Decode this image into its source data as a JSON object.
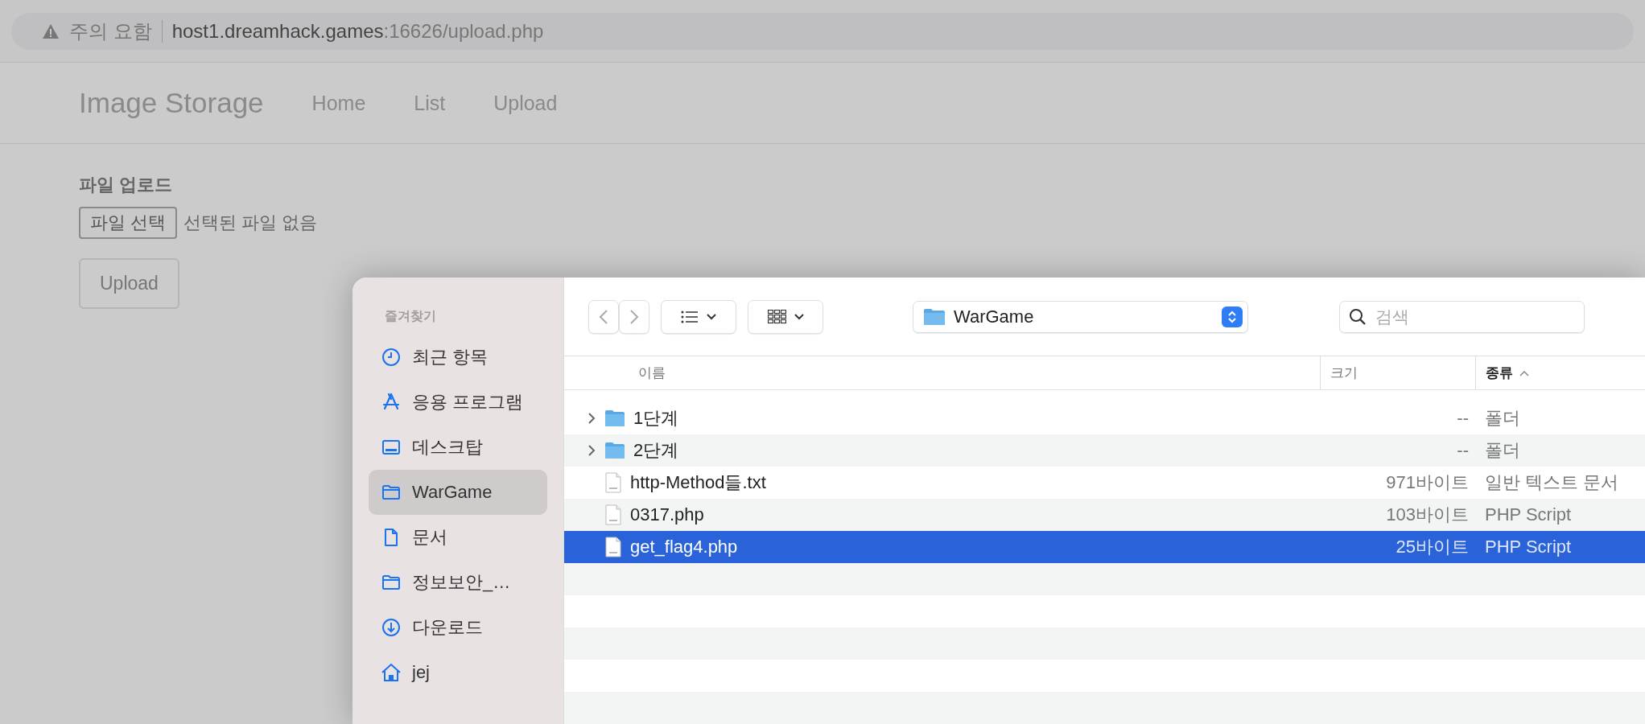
{
  "browser": {
    "warning": "주의 요함",
    "url_host": "host1.dreamhack.games",
    "url_rest": ":16626/upload.php"
  },
  "site": {
    "brand": "Image Storage",
    "nav": [
      {
        "label": "Home"
      },
      {
        "label": "List"
      },
      {
        "label": "Upload"
      }
    ],
    "heading": "파일 업로드",
    "file_button": "파일 선택",
    "file_status": "선택된 파일 없음",
    "upload_button": "Upload"
  },
  "dialog": {
    "sidebar": {
      "section": "즐겨찾기",
      "items": [
        {
          "label": "최근 항목",
          "kind": "recent",
          "selected": false
        },
        {
          "label": "응용 프로그램",
          "kind": "apps",
          "selected": false
        },
        {
          "label": "데스크탑",
          "kind": "desktop",
          "selected": false
        },
        {
          "label": "WarGame",
          "kind": "folder",
          "selected": true
        },
        {
          "label": "문서",
          "kind": "document",
          "selected": false
        },
        {
          "label": "정보보안_…",
          "kind": "folder",
          "selected": false
        },
        {
          "label": "다운로드",
          "kind": "download",
          "selected": false
        },
        {
          "label": "jej",
          "kind": "home",
          "selected": false
        }
      ]
    },
    "toolbar": {
      "location": "WarGame",
      "search_placeholder": "검색"
    },
    "columns": [
      {
        "label": "이름",
        "sorted": false
      },
      {
        "label": "크기",
        "sorted": false
      },
      {
        "label": "종류",
        "sorted": true
      }
    ],
    "rows": [
      {
        "name": "1단계",
        "size": "--",
        "type": "폴더",
        "kind": "folder",
        "expanded": false,
        "selected": false
      },
      {
        "name": "2단계",
        "size": "--",
        "type": "폴더",
        "kind": "folder",
        "expanded": false,
        "selected": false
      },
      {
        "name": "http-Method들.txt",
        "size": "971바이트",
        "type": "일반 텍스트 문서",
        "kind": "file",
        "selected": false
      },
      {
        "name": "0317.php",
        "size": "103바이트",
        "type": "PHP Script",
        "kind": "file",
        "selected": false
      },
      {
        "name": "get_flag4.php",
        "size": "25바이트",
        "type": "PHP Script",
        "kind": "file",
        "selected": true
      }
    ]
  }
}
